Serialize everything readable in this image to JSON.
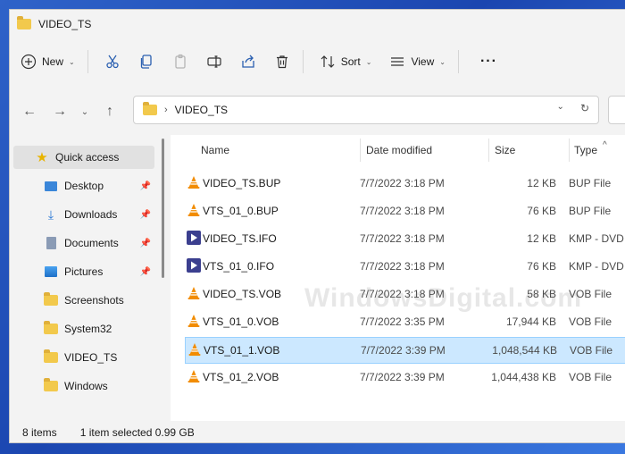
{
  "window": {
    "title": "VIDEO_TS"
  },
  "toolbar": {
    "new_label": "New",
    "sort_label": "Sort",
    "view_label": "View",
    "more_label": "···"
  },
  "address": {
    "path": "VIDEO_TS"
  },
  "sidebar": {
    "items": [
      {
        "label": "Quick access",
        "icon": "star-icon",
        "pinned": false,
        "selected": true
      },
      {
        "label": "Desktop",
        "icon": "desktop-icon",
        "pinned": true
      },
      {
        "label": "Downloads",
        "icon": "download-icon",
        "pinned": true
      },
      {
        "label": "Documents",
        "icon": "document-icon",
        "pinned": true
      },
      {
        "label": "Pictures",
        "icon": "picture-icon",
        "pinned": true
      },
      {
        "label": "Screenshots",
        "icon": "folder-icon",
        "pinned": false
      },
      {
        "label": "System32",
        "icon": "folder-icon",
        "pinned": false
      },
      {
        "label": "VIDEO_TS",
        "icon": "folder-icon",
        "pinned": false
      },
      {
        "label": "Windows",
        "icon": "folder-icon",
        "pinned": false
      }
    ]
  },
  "columns": {
    "name": "Name",
    "date": "Date modified",
    "size": "Size",
    "type": "Type"
  },
  "files": [
    {
      "name": "VIDEO_TS.BUP",
      "date": "7/7/2022 3:18 PM",
      "size": "12 KB",
      "type": "BUP File",
      "icon": "vlc-cone-icon"
    },
    {
      "name": "VTS_01_0.BUP",
      "date": "7/7/2022 3:18 PM",
      "size": "76 KB",
      "type": "BUP File",
      "icon": "vlc-cone-icon"
    },
    {
      "name": "VIDEO_TS.IFO",
      "date": "7/7/2022 3:18 PM",
      "size": "12 KB",
      "type": "KMP - DVD",
      "icon": "kmp-icon"
    },
    {
      "name": "VTS_01_0.IFO",
      "date": "7/7/2022 3:18 PM",
      "size": "76 KB",
      "type": "KMP - DVD",
      "icon": "kmp-icon"
    },
    {
      "name": "VIDEO_TS.VOB",
      "date": "7/7/2022 3:18 PM",
      "size": "58 KB",
      "type": "VOB File",
      "icon": "vlc-cone-icon"
    },
    {
      "name": "VTS_01_0.VOB",
      "date": "7/7/2022 3:35 PM",
      "size": "17,944 KB",
      "type": "VOB File",
      "icon": "vlc-cone-icon"
    },
    {
      "name": "VTS_01_1.VOB",
      "date": "7/7/2022 3:39 PM",
      "size": "1,048,544 KB",
      "type": "VOB File",
      "icon": "vlc-cone-icon",
      "selected": true
    },
    {
      "name": "VTS_01_2.VOB",
      "date": "7/7/2022 3:39 PM",
      "size": "1,044,438 KB",
      "type": "VOB File",
      "icon": "vlc-cone-icon"
    }
  ],
  "status": {
    "item_count": "8 items",
    "selection": "1 item selected  0.99 GB"
  },
  "watermark": "WindowsDigital.com",
  "colors": {
    "selection_bg": "#cce8ff",
    "selection_border": "#99d1ff",
    "folder": "#f2c94c",
    "vlc_orange": "#f28c00",
    "kmp_purple": "#3b3f8f"
  }
}
